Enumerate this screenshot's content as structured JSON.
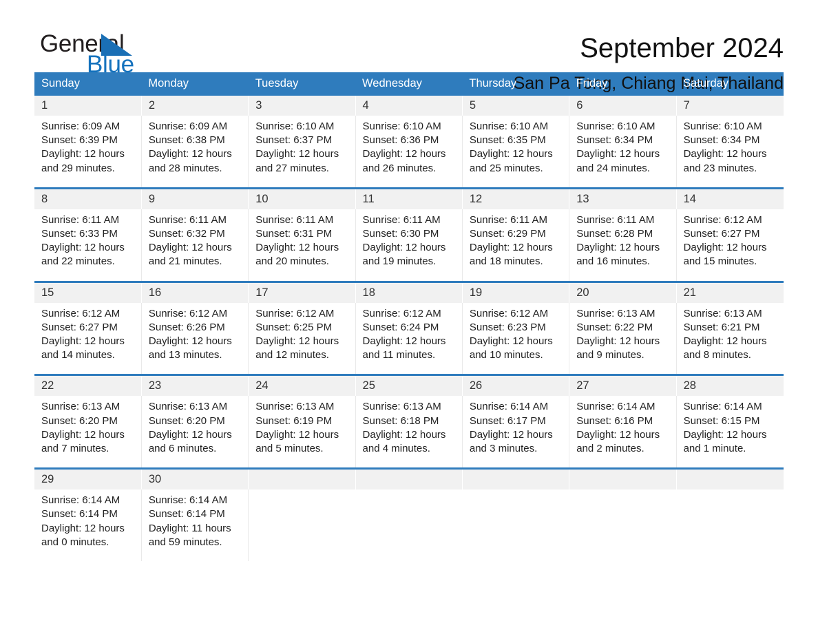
{
  "brand": {
    "name_part1": "General",
    "name_part2": "Blue",
    "triangle_color": "#1a6fb5",
    "blue_text_color": "#1572bd"
  },
  "header": {
    "title": "September 2024",
    "subtitle": "San Pa Tong, Chiang Mai, Thailand"
  },
  "theme": {
    "header_bar": "#2f7cbd",
    "daynum_band": "#f1f1f1",
    "rule": "#2f7cbd"
  },
  "weekday_headers": [
    "Sunday",
    "Monday",
    "Tuesday",
    "Wednesday",
    "Thursday",
    "Friday",
    "Saturday"
  ],
  "weeks": [
    {
      "days": [
        {
          "date": "1",
          "sunrise": "Sunrise: 6:09 AM",
          "sunset": "Sunset: 6:39 PM",
          "daylight_line1": "Daylight: 12 hours",
          "daylight_line2": "and 29 minutes."
        },
        {
          "date": "2",
          "sunrise": "Sunrise: 6:09 AM",
          "sunset": "Sunset: 6:38 PM",
          "daylight_line1": "Daylight: 12 hours",
          "daylight_line2": "and 28 minutes."
        },
        {
          "date": "3",
          "sunrise": "Sunrise: 6:10 AM",
          "sunset": "Sunset: 6:37 PM",
          "daylight_line1": "Daylight: 12 hours",
          "daylight_line2": "and 27 minutes."
        },
        {
          "date": "4",
          "sunrise": "Sunrise: 6:10 AM",
          "sunset": "Sunset: 6:36 PM",
          "daylight_line1": "Daylight: 12 hours",
          "daylight_line2": "and 26 minutes."
        },
        {
          "date": "5",
          "sunrise": "Sunrise: 6:10 AM",
          "sunset": "Sunset: 6:35 PM",
          "daylight_line1": "Daylight: 12 hours",
          "daylight_line2": "and 25 minutes."
        },
        {
          "date": "6",
          "sunrise": "Sunrise: 6:10 AM",
          "sunset": "Sunset: 6:34 PM",
          "daylight_line1": "Daylight: 12 hours",
          "daylight_line2": "and 24 minutes."
        },
        {
          "date": "7",
          "sunrise": "Sunrise: 6:10 AM",
          "sunset": "Sunset: 6:34 PM",
          "daylight_line1": "Daylight: 12 hours",
          "daylight_line2": "and 23 minutes."
        }
      ]
    },
    {
      "days": [
        {
          "date": "8",
          "sunrise": "Sunrise: 6:11 AM",
          "sunset": "Sunset: 6:33 PM",
          "daylight_line1": "Daylight: 12 hours",
          "daylight_line2": "and 22 minutes."
        },
        {
          "date": "9",
          "sunrise": "Sunrise: 6:11 AM",
          "sunset": "Sunset: 6:32 PM",
          "daylight_line1": "Daylight: 12 hours",
          "daylight_line2": "and 21 minutes."
        },
        {
          "date": "10",
          "sunrise": "Sunrise: 6:11 AM",
          "sunset": "Sunset: 6:31 PM",
          "daylight_line1": "Daylight: 12 hours",
          "daylight_line2": "and 20 minutes."
        },
        {
          "date": "11",
          "sunrise": "Sunrise: 6:11 AM",
          "sunset": "Sunset: 6:30 PM",
          "daylight_line1": "Daylight: 12 hours",
          "daylight_line2": "and 19 minutes."
        },
        {
          "date": "12",
          "sunrise": "Sunrise: 6:11 AM",
          "sunset": "Sunset: 6:29 PM",
          "daylight_line1": "Daylight: 12 hours",
          "daylight_line2": "and 18 minutes."
        },
        {
          "date": "13",
          "sunrise": "Sunrise: 6:11 AM",
          "sunset": "Sunset: 6:28 PM",
          "daylight_line1": "Daylight: 12 hours",
          "daylight_line2": "and 16 minutes."
        },
        {
          "date": "14",
          "sunrise": "Sunrise: 6:12 AM",
          "sunset": "Sunset: 6:27 PM",
          "daylight_line1": "Daylight: 12 hours",
          "daylight_line2": "and 15 minutes."
        }
      ]
    },
    {
      "days": [
        {
          "date": "15",
          "sunrise": "Sunrise: 6:12 AM",
          "sunset": "Sunset: 6:27 PM",
          "daylight_line1": "Daylight: 12 hours",
          "daylight_line2": "and 14 minutes."
        },
        {
          "date": "16",
          "sunrise": "Sunrise: 6:12 AM",
          "sunset": "Sunset: 6:26 PM",
          "daylight_line1": "Daylight: 12 hours",
          "daylight_line2": "and 13 minutes."
        },
        {
          "date": "17",
          "sunrise": "Sunrise: 6:12 AM",
          "sunset": "Sunset: 6:25 PM",
          "daylight_line1": "Daylight: 12 hours",
          "daylight_line2": "and 12 minutes."
        },
        {
          "date": "18",
          "sunrise": "Sunrise: 6:12 AM",
          "sunset": "Sunset: 6:24 PM",
          "daylight_line1": "Daylight: 12 hours",
          "daylight_line2": "and 11 minutes."
        },
        {
          "date": "19",
          "sunrise": "Sunrise: 6:12 AM",
          "sunset": "Sunset: 6:23 PM",
          "daylight_line1": "Daylight: 12 hours",
          "daylight_line2": "and 10 minutes."
        },
        {
          "date": "20",
          "sunrise": "Sunrise: 6:13 AM",
          "sunset": "Sunset: 6:22 PM",
          "daylight_line1": "Daylight: 12 hours",
          "daylight_line2": "and 9 minutes."
        },
        {
          "date": "21",
          "sunrise": "Sunrise: 6:13 AM",
          "sunset": "Sunset: 6:21 PM",
          "daylight_line1": "Daylight: 12 hours",
          "daylight_line2": "and 8 minutes."
        }
      ]
    },
    {
      "days": [
        {
          "date": "22",
          "sunrise": "Sunrise: 6:13 AM",
          "sunset": "Sunset: 6:20 PM",
          "daylight_line1": "Daylight: 12 hours",
          "daylight_line2": "and 7 minutes."
        },
        {
          "date": "23",
          "sunrise": "Sunrise: 6:13 AM",
          "sunset": "Sunset: 6:20 PM",
          "daylight_line1": "Daylight: 12 hours",
          "daylight_line2": "and 6 minutes."
        },
        {
          "date": "24",
          "sunrise": "Sunrise: 6:13 AM",
          "sunset": "Sunset: 6:19 PM",
          "daylight_line1": "Daylight: 12 hours",
          "daylight_line2": "and 5 minutes."
        },
        {
          "date": "25",
          "sunrise": "Sunrise: 6:13 AM",
          "sunset": "Sunset: 6:18 PM",
          "daylight_line1": "Daylight: 12 hours",
          "daylight_line2": "and 4 minutes."
        },
        {
          "date": "26",
          "sunrise": "Sunrise: 6:14 AM",
          "sunset": "Sunset: 6:17 PM",
          "daylight_line1": "Daylight: 12 hours",
          "daylight_line2": "and 3 minutes."
        },
        {
          "date": "27",
          "sunrise": "Sunrise: 6:14 AM",
          "sunset": "Sunset: 6:16 PM",
          "daylight_line1": "Daylight: 12 hours",
          "daylight_line2": "and 2 minutes."
        },
        {
          "date": "28",
          "sunrise": "Sunrise: 6:14 AM",
          "sunset": "Sunset: 6:15 PM",
          "daylight_line1": "Daylight: 12 hours",
          "daylight_line2": "and 1 minute."
        }
      ]
    },
    {
      "days": [
        {
          "date": "29",
          "sunrise": "Sunrise: 6:14 AM",
          "sunset": "Sunset: 6:14 PM",
          "daylight_line1": "Daylight: 12 hours",
          "daylight_line2": "and 0 minutes."
        },
        {
          "date": "30",
          "sunrise": "Sunrise: 6:14 AM",
          "sunset": "Sunset: 6:14 PM",
          "daylight_line1": "Daylight: 11 hours",
          "daylight_line2": "and 59 minutes."
        },
        {
          "date": "",
          "sunrise": "",
          "sunset": "",
          "daylight_line1": "",
          "daylight_line2": ""
        },
        {
          "date": "",
          "sunrise": "",
          "sunset": "",
          "daylight_line1": "",
          "daylight_line2": ""
        },
        {
          "date": "",
          "sunrise": "",
          "sunset": "",
          "daylight_line1": "",
          "daylight_line2": ""
        },
        {
          "date": "",
          "sunrise": "",
          "sunset": "",
          "daylight_line1": "",
          "daylight_line2": ""
        },
        {
          "date": "",
          "sunrise": "",
          "sunset": "",
          "daylight_line1": "",
          "daylight_line2": ""
        }
      ]
    }
  ]
}
